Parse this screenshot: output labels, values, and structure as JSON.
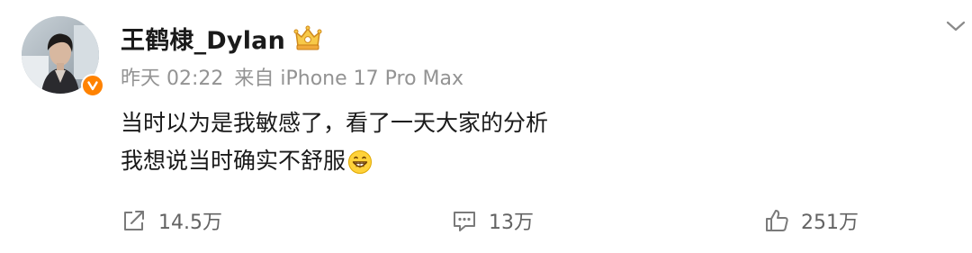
{
  "post": {
    "author": {
      "name": "王鹤棣_Dylan",
      "verified": true,
      "badge_color": "#ff8200"
    },
    "meta": {
      "time": "昨天 02:22",
      "source": "来自 iPhone 17 Pro Max"
    },
    "content": {
      "lines": [
        "当时以为是我敏感了，看了一天大家的分析",
        "我想说当时确实不舒服"
      ],
      "trailing_emoji": "grinning-face"
    },
    "actions": {
      "repost_count": "14.5万",
      "comment_count": "13万",
      "like_count": "251万"
    }
  },
  "icons": {
    "expand": "chevron-down-icon",
    "member": "crown-member-icon",
    "repost": "repost-icon",
    "comment": "comment-icon",
    "like": "thumbs-up-icon"
  },
  "colors": {
    "text_primary": "#1a1a1a",
    "text_meta": "#939393",
    "action_text": "#636363",
    "member_gold": "#f5a623"
  }
}
